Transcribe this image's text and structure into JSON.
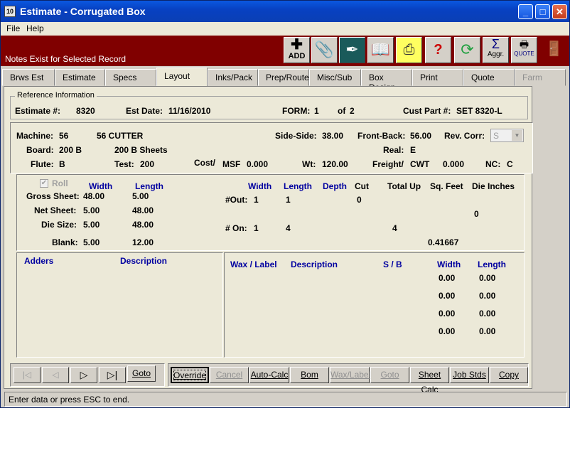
{
  "window": {
    "title": "Estimate - Corrugated Box",
    "controls": [
      "_",
      "□",
      "✕"
    ]
  },
  "menu": {
    "file": "File",
    "help": "Help"
  },
  "toolbar": {
    "notes": "Notes Exist for Selected Record",
    "add_label": "ADD",
    "aggr_label": "Aggr.",
    "quote_label": "QUOTE"
  },
  "tabs": [
    "Brws Est",
    "Estimate",
    "Specs",
    "Layout",
    "Inks/Pack",
    "Prep/Route",
    "Misc/Sub",
    "Box Design",
    "Print",
    "Quote",
    "Farm"
  ],
  "ref": {
    "legend": "Reference Information",
    "estimate_label": "Estimate #:",
    "estimate": "8320",
    "date_label": "Est Date:",
    "date": "11/16/2010",
    "form_label": "FORM:",
    "form": "1",
    "of_label": "of",
    "of": "2",
    "cust_label": "Cust Part #:",
    "cust": "SET 8320-L"
  },
  "machine": {
    "machine_label": "Machine:",
    "machine_code": "56",
    "machine_name": "56 CUTTER",
    "board_label": "Board:",
    "board_code": "200 B",
    "board_name": "200 B Sheets",
    "flute_label": "Flute:",
    "flute": "B",
    "test_label": "Test:",
    "test": "200",
    "side_label": "Side-Side:",
    "side": "38.00",
    "front_label": "Front-Back:",
    "front": "56.00",
    "rev_label": "Rev. Corr:",
    "rev": "S",
    "real_label": "Real:",
    "real": "E",
    "cost_label": "Cost/",
    "msf_label": "MSF",
    "msf": "0.000",
    "wt_label": "Wt:",
    "wt": "120.00",
    "freight_label": "Freight/",
    "cwt_label": "CWT",
    "cwt": "0.000",
    "nc_label": "NC:",
    "nc": "C"
  },
  "sheet": {
    "roll": "Roll",
    "width_h": "Width",
    "length_h": "Length",
    "gross_label": "Gross Sheet:",
    "gross_w": "48.00",
    "gross_l": "5.00",
    "net_label": "Net Sheet:",
    "net_w": "5.00",
    "net_l": "48.00",
    "die_label": "Die Size:",
    "die_w": "5.00",
    "die_l": "48.00",
    "blank_label": "Blank:",
    "blank_w": "5.00",
    "blank_l": "12.00",
    "w_h2": "Width",
    "l_h2": "Length",
    "depth_h": "Depth",
    "cut_h": "Cut",
    "total_h": "Total Up",
    "sqft_h": "Sq. Feet",
    "die_in_h": "Die Inches",
    "out_label": "#Out:",
    "out_w": "1",
    "out_l": "1",
    "out_cut": "0",
    "on_label": "# On:",
    "on_w": "1",
    "on_l": "4",
    "on_total": "4",
    "die_in": "0",
    "sqft": "0.41667"
  },
  "adders": {
    "adders_h": "Adders",
    "desc_h": "Description"
  },
  "wax": {
    "wax_h": "Wax / Label",
    "desc_h": "Description",
    "sb_h": "S  /  B",
    "width_h": "Width",
    "length_h": "Length",
    "rows": [
      [
        "0.00",
        "0.00"
      ],
      [
        "0.00",
        "0.00"
      ],
      [
        "0.00",
        "0.00"
      ],
      [
        "0.00",
        "0.00"
      ]
    ]
  },
  "nav": {
    "goto": "Goto"
  },
  "buttons": {
    "override": "Override",
    "cancel": "Cancel",
    "autocalc": "Auto-Calc",
    "bom": "Bom",
    "waxlabel": "Wax/Label",
    "goto": "Goto",
    "sheetcalc": "Sheet Calc",
    "jobstds": "Job Stds",
    "copy": "Copy"
  },
  "status": "Enter data or press ESC to end."
}
